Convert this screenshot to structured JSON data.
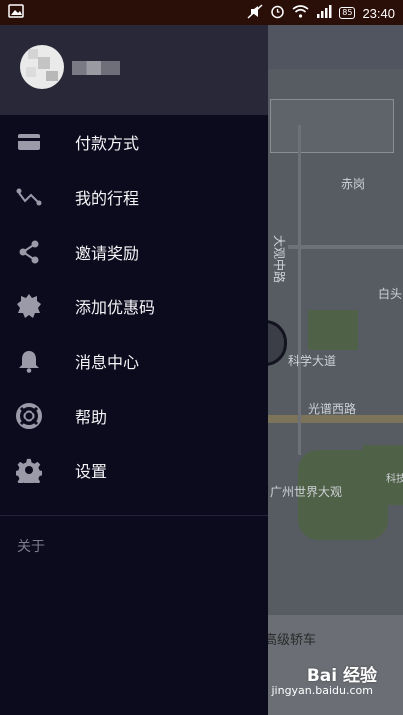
{
  "status_bar": {
    "time": "23:40",
    "battery": "85",
    "icons": [
      "image-icon",
      "mute-icon",
      "alarm-icon",
      "wifi-icon",
      "signal-icon",
      "battery-icon"
    ]
  },
  "drawer": {
    "items": [
      {
        "label": "付款方式",
        "icon": "card-icon"
      },
      {
        "label": "我的行程",
        "icon": "route-icon"
      },
      {
        "label": "邀请奖励",
        "icon": "share-icon"
      },
      {
        "label": "添加优惠码",
        "icon": "badge-icon"
      },
      {
        "label": "消息中心",
        "icon": "bell-icon"
      },
      {
        "label": "帮助",
        "icon": "lifebuoy-icon"
      },
      {
        "label": "设置",
        "icon": "gear-icon"
      }
    ],
    "about": "关于"
  },
  "map": {
    "labels": [
      "赤岗",
      "大观中路",
      "白头",
      "科学大道",
      "光谱西路",
      "广州世界大观",
      "科技"
    ],
    "bottom_label": "高级轿车"
  },
  "watermark": {
    "brand": "Bai 经验",
    "url": "jingyan.baidu.com"
  },
  "colors": {
    "drawer_bg": "#0c0a1d",
    "header_bg": "#292838",
    "map_bg": "#575c63"
  }
}
